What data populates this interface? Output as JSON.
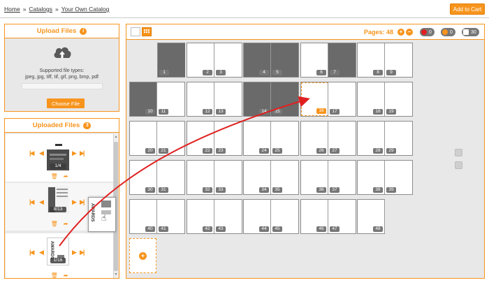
{
  "breadcrumb": {
    "home": "Home",
    "catalogs": "Catalogs",
    "current": "Your Own Catalog",
    "sep": "»"
  },
  "actions": {
    "add_to_cart": "Add to Cart"
  },
  "upload": {
    "title": "Upload Files",
    "info": "i",
    "supported_label": "Supported file types:",
    "types": "jpeg, jpg, tiff, tif, gif, png, bmp, pdf",
    "choose_label": "Choose File"
  },
  "uploaded": {
    "title": "Uploaded Files",
    "count": "3",
    "files": [
      {
        "badge": "1/4",
        "nav_prev": "◀",
        "nav_next": "▶"
      },
      {
        "badge": "8/13",
        "nav_prev": "◀",
        "nav_next": "▶"
      },
      {
        "badge": "1/16",
        "nav_prev": "◀",
        "nav_next": "▶"
      }
    ]
  },
  "main": {
    "pages_label": "Pages: 48",
    "plus": "+",
    "minus": "−",
    "stats": {
      "errors": "0",
      "warnings": "0",
      "total": "30"
    }
  },
  "pages": [
    "1",
    "2",
    "3",
    "4",
    "5",
    "6",
    "7",
    "8",
    "9",
    "10",
    "11",
    "12",
    "13",
    "14",
    "15",
    "16",
    "17",
    "18",
    "19",
    "20",
    "21",
    "22",
    "23",
    "24",
    "25",
    "26",
    "27",
    "28",
    "29",
    "30",
    "31",
    "32",
    "33",
    "34",
    "35",
    "36",
    "37",
    "38",
    "39",
    "40",
    "41",
    "42",
    "43",
    "44",
    "45",
    "46",
    "47",
    "48"
  ],
  "drag_ghost_text": "AWARDS",
  "colors": {
    "accent": "#f7941d",
    "arrow": "#e02020"
  }
}
